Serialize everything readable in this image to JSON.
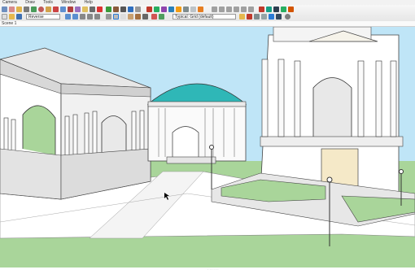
{
  "menu": {
    "items": [
      "Camera",
      "Draw",
      "Tools",
      "Window",
      "Help"
    ]
  },
  "toolbar": {
    "style_dropdown": "Reverse",
    "layer_dropdown": "Typical: Grid (default)",
    "accent": "#2a7bd6"
  },
  "status": {
    "tab_label": "Scene 1"
  },
  "viewport": {
    "sky_color": "#bfe5f7",
    "ground_color": "#a9d59a",
    "dome_color": "#2fb7b7"
  },
  "footer": {
    "hint": "· · · · · ·"
  }
}
